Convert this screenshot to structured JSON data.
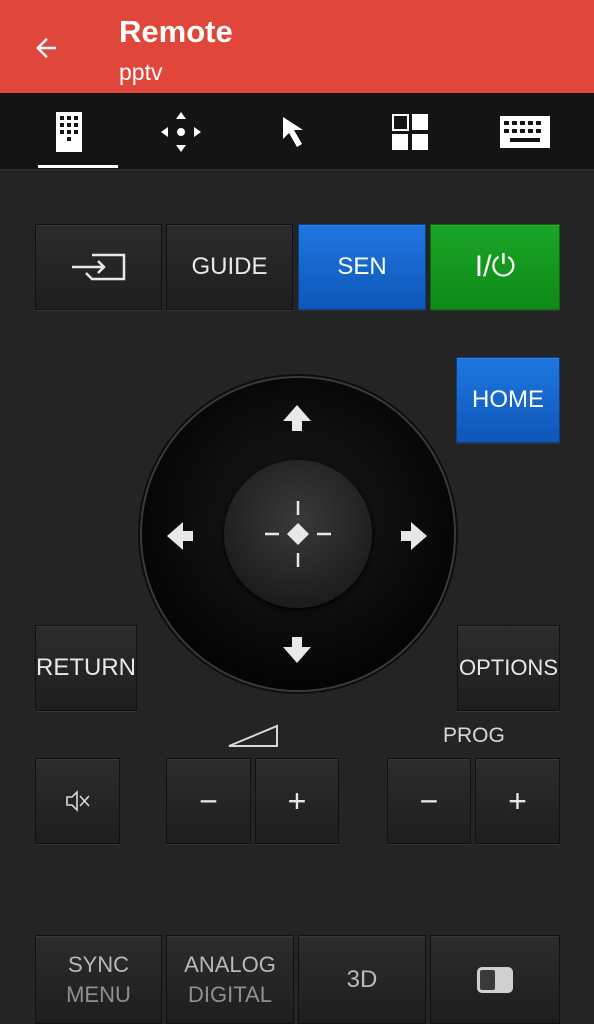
{
  "appbar": {
    "title": "Remote",
    "subtitle": "pptv",
    "back_icon": "arrow-left-icon",
    "color": "#e0473a"
  },
  "tabs": [
    {
      "icon": "remote-keypad-icon",
      "active": true
    },
    {
      "icon": "dpad-icon",
      "active": false
    },
    {
      "icon": "pointer-icon",
      "active": false
    },
    {
      "icon": "apps-grid-icon",
      "active": false
    },
    {
      "icon": "keyboard-icon",
      "active": false
    }
  ],
  "buttons": {
    "input_icon": "input-source-icon",
    "guide": "GUIDE",
    "sen": "SEN",
    "power": "I/⏻",
    "home": "HOME",
    "return": "RETURN",
    "options": "OPTIONS",
    "mute_icon": "mute-icon",
    "vol_minus": "−",
    "vol_plus": "+",
    "prog_label": "PROG",
    "prog_minus": "−",
    "prog_plus": "+",
    "sync_top": "SYNC",
    "sync_bottom": "MENU",
    "analog_top": "ANALOG",
    "analog_bottom": "DIGITAL",
    "threed": "3D",
    "picture_icon": "picture-mode-icon"
  },
  "colors": {
    "sen": "#1565c8",
    "power": "#12961e",
    "home": "#1565c8"
  }
}
